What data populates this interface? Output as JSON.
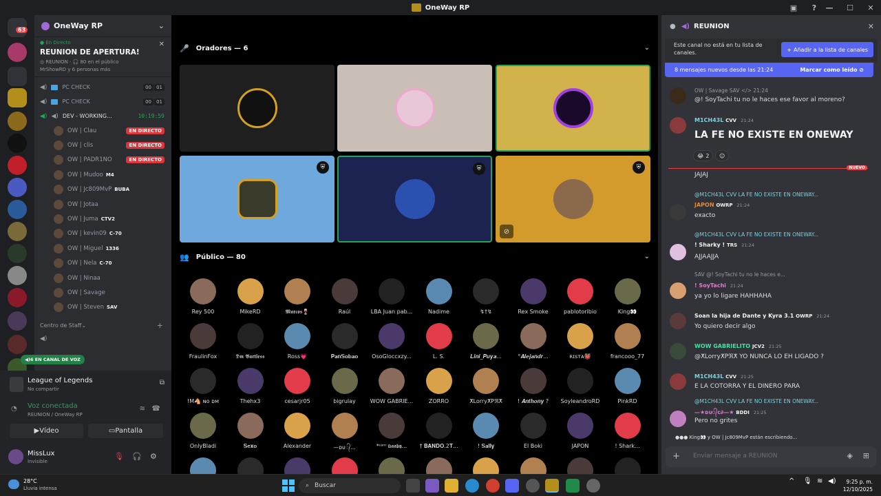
{
  "window": {
    "title": "OneWay RP"
  },
  "rail": {
    "badge": "63"
  },
  "server": {
    "name": "OneWay RP"
  },
  "event": {
    "status": "En Directo",
    "title": "REUNION DE APERTURA!",
    "channel": "REUNION",
    "audience": "80 en el público",
    "people": "MrShowRD y 6 personas más"
  },
  "channels": [
    {
      "name": "PC CHECK",
      "a": "00",
      "b": "01"
    },
    {
      "name": "PC CHECK",
      "a": "00",
      "b": "01"
    },
    {
      "name": "DEV - WORKING...",
      "timer": "10:19:59"
    }
  ],
  "voice_users": [
    {
      "name": "OW | Clau",
      "live": "EN DIRECTO"
    },
    {
      "name": "OW | clis",
      "live": "EN DIRECTO"
    },
    {
      "name": "OW | PADR1NO",
      "live": "EN DIRECTO"
    },
    {
      "name": "OW | Mudoo",
      "tag": "M4"
    },
    {
      "name": "OW | Jc809MvP",
      "tag": "BUBA"
    },
    {
      "name": "OW | Jotaa"
    },
    {
      "name": "OW | Juma",
      "tag": "CTV2"
    },
    {
      "name": "OW | kevin09",
      "tag": "C-70"
    },
    {
      "name": "OW | Miguel",
      "tag": "1336"
    },
    {
      "name": "OW | Nela",
      "tag": "C-70"
    },
    {
      "name": "OW | Ninaa"
    },
    {
      "name": "OW | Savage"
    },
    {
      "name": "OW | Steven",
      "tag": "SAV"
    }
  ],
  "category": {
    "name": "Centro de Staff",
    "voice_pill": "6 EN CANAL DE VOZ"
  },
  "game": {
    "title": "League of Legends",
    "sub": "No compartir"
  },
  "voice": {
    "title": "Voz conectada",
    "sub": "REUNION / OneWay RP"
  },
  "buttons": {
    "video": "Vídeo",
    "screen": "Pantalla"
  },
  "me": {
    "name": "MissLux",
    "status": "Invisible"
  },
  "stage": {
    "speakers_header": "Oradores — 6",
    "audience_header": "Público — 80",
    "tile_colors": [
      "#1f1f1f",
      "#c9bfb7",
      "#d2b24a",
      "#6ea8dd",
      "#1c2350",
      "#d39a2c"
    ],
    "audience": [
      [
        "Rey 500",
        "MikeRD",
        "𝕸𝖆𝖗𝖈𝖔𝖘🍷",
        "Raúl",
        "LBA Juan pab...",
        "Nadime",
        "↯†↯",
        "Rex Smoke",
        "pablotoribio",
        "King👀"
      ],
      [
        "FraulinFox",
        "𝕯𝖒 𝕭𝖆𝖗𝖙𝖑𝖊𝖘𝖘",
        "Ross💗",
        "𝐏𝐚𝐧𝐒𝐨𝐛𝐚𝐨",
        "OsoGloccxzy...",
        "L. S.",
        "𝑳𝒊𝒏𝒊_𝑷𝒖𝒚𝒂...",
        "°𝑨𝒍𝒆𝒋𝒂𝒏𝒅𝒓...",
        "ʀɪꜱᴛᴀ👹",
        "francooo_77"
      ],
      [
        "!M🐴 ɴᴏ ᴅᴍ",
        "Thehx3",
        "cesarjr05",
        "bigrulay",
        "WOW GABRIE...",
        "ZORRO",
        "ⵅLorryⵅPℜⵅ",
        "! 𝑨𝒏𝒕𝒉𝒐𝒏𝒚 ?",
        "SoyleandroRD",
        "PinkRD"
      ],
      [
        "OnlyBladi",
        "𝐒𝐞𝐱𝐨",
        "Alexander",
        "—ᴅᴜ᭄...",
        "*ᶦᵃᵐ ʙ𝖆𝖆𝖇𝖞...",
        "† 𝐁𝐀𝐍𝐃𝐎.2𝐓...",
        "! 𝐒𝐚𝐥𝐥𝐲",
        "El Boki",
        "JAPON",
        "! Shark..."
      ]
    ],
    "audience_colors": [
      "#8a6a5a",
      "#d9a24a",
      "#b08050",
      "#4a3a3a",
      "#222",
      "#5a8ab0",
      "#2a2a2a",
      "#4a3a6a",
      "#e23b4a",
      "#6a6a4a"
    ]
  },
  "chat": {
    "channel": "REUNION",
    "notice": "Este canal no está en tu lista de canales.",
    "add_button": "Añadir a la lista de canales",
    "new_messages": "8 mensajes nuevos desde las 21:24",
    "mark_read": "Marcar como leído",
    "nuevo": "NUEVO",
    "messages": [
      {
        "reply": "OW | Savage  SAV  </> 21:24",
        "body": "@!    SoyTachi tu no le haces ese favor al moreno?"
      },
      {
        "author": "M1CH43L",
        "tag": "CVV",
        "time": "21:24",
        "body": "LA FE NO EXISTE EN ONEWAY",
        "reaction": "2"
      },
      {
        "body": "JAJAJ"
      },
      {
        "reply": "@M1CH43L  CVV  LA FE NO EXISTE EN ONEWAY...",
        "author": "JAPON",
        "tag": "OWRP",
        "time": "21:24",
        "body": "exacto"
      },
      {
        "reply": "@M1CH43L  CVV  LA FE NO EXISTE EN ONEWAY...",
        "author": "! Sharky !",
        "tag": "TRS",
        "time": "21:24",
        "body": "AJJAAJJA"
      },
      {
        "reply": "SAV  @!    SoyTachi tu no le haces e...",
        "author": "!      SoyTachi",
        "time": "21:24",
        "body": "ya yo lo ligare HAHHAHA"
      },
      {
        "author": "Soan la hija de Dante y Kyra 3.1",
        "tag": "OWRP",
        "time": "21:24",
        "body": "Yo quiero decir algo"
      },
      {
        "author": "WOW GABRIELITO",
        "tag": "JCV2",
        "time": "21:25",
        "body": "@ⵅLorryⵅPℜⵅ YO NUNCA LO EH LIGADO ?"
      },
      {
        "author": "M1CH43L",
        "tag": "CVV",
        "time": "21:25",
        "body": "E LA COTORRA Y EL DINERO PARA"
      },
      {
        "reply": "@M1CH43L  CVV  LA FE NO EXISTE EN ONEWAY...",
        "author": "—★ᴅᴜ᭄ᴄ∂—★",
        "tag": "BDDI",
        "time": "21:25",
        "body": "Pero no grites"
      }
    ],
    "typing": "King👀 y OW | Jc809MvP están escribiendo...",
    "placeholder": "Enviar mensaje a  REUNION"
  },
  "taskbar": {
    "temp": "28°C",
    "weather": "Lluvia intensa",
    "search": "Buscar",
    "time": "9:25 p. m.",
    "date": "12/10/2025"
  }
}
